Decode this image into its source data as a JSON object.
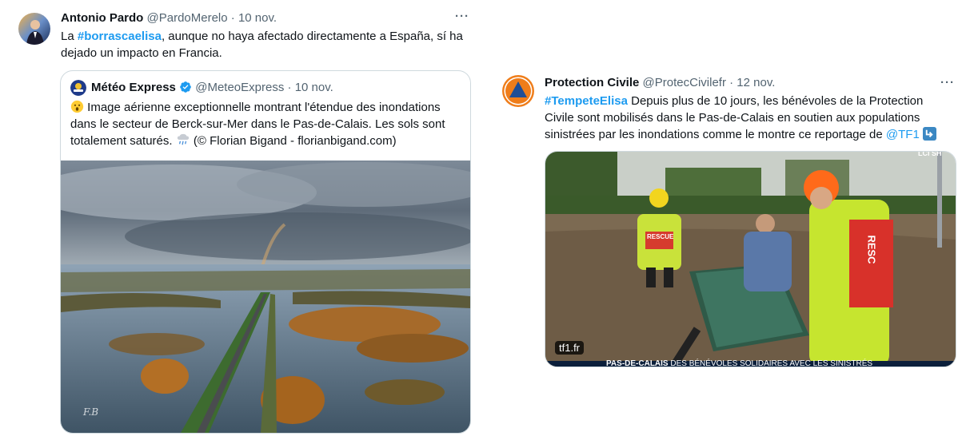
{
  "left_tweet": {
    "name": "Antonio Pardo",
    "handle": "@PardoMerelo",
    "dot": "·",
    "date": "10 nov.",
    "more": "···",
    "text_pre": "La ",
    "hashtag": "#borrascaelisa",
    "text_line1_rest": ", aunque no haya afectado directamente a España, sí ha",
    "text_line2": "dejado un impacto en Francia.",
    "quote": {
      "name": "Météo Express",
      "handle": "@MeteoExpress",
      "dot": "·",
      "date": "10 nov.",
      "line1": "Image aérienne exceptionnelle montrant l'étendue des inondations",
      "line2": "dans le secteur de Berck-sur-Mer dans le Pas-de-Calais. Les sols sont",
      "line3": "totalement saturés.",
      "line3_rest": " (© Florian Bigand - florianbigand.com)",
      "emoji_lead": "surprised-face-icon",
      "emoji_rain": "rain-cloud-icon",
      "watermark": "F.B"
    }
  },
  "right_tweet": {
    "name": "Protection Civile",
    "handle": "@ProtecCivilefr",
    "dot": "·",
    "date": "12 nov.",
    "more": "···",
    "hashtag": "#TempeteElisa",
    "line1_rest": " Depuis plus de 10 jours, les bénévoles de la Protection",
    "line2": "Civile sont mobilisés dans le Pas-de-Calais en soutien aux populations",
    "line3_pre": "sinistrées par les inondations comme le montre ce reportage de ",
    "mention": "@TF1",
    "arrow_icon": "arrow-down-right-icon",
    "media": {
      "source_badge": "tf1.fr",
      "rescue_label": "RESCUE",
      "rescue_label2": "RESC",
      "chyron_bold": "PAS-DE-CALAIS",
      "chyron_text": "DES BÉNÉVOLES SOLIDAIRES AVEC LES SINISTRÉS",
      "channel_tag": "LCI SH"
    }
  },
  "colors": {
    "accent": "#1d9bf0",
    "text": "#0f1419",
    "muted": "#536471",
    "border": "#cfd9de"
  }
}
